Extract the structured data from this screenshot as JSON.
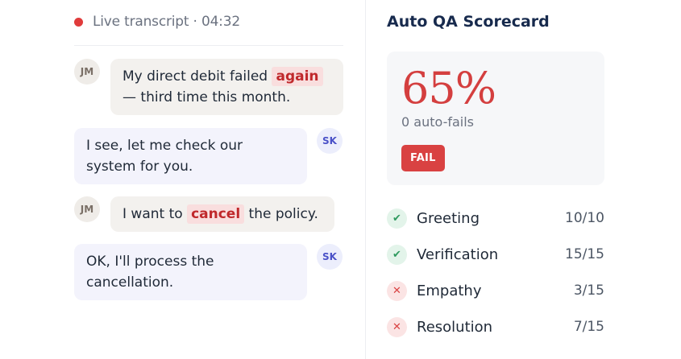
{
  "transcript": {
    "header": "Live transcript · 04:32",
    "messages": [
      {
        "speaker": "JM",
        "role": "customer",
        "pre": "My direct debit failed ",
        "keyword": "again",
        "post": "— third time this month."
      },
      {
        "speaker": "SK",
        "role": "agent",
        "text": "I see, let me check our system for you."
      },
      {
        "speaker": "JM",
        "role": "customer",
        "pre": "I want to ",
        "keyword": "cancel",
        "post": " the policy."
      },
      {
        "speaker": "SK",
        "role": "agent",
        "text": "OK, I'll process the cancellation."
      }
    ]
  },
  "scorecard": {
    "title": "Auto QA Scorecard",
    "score": "65%",
    "auto_fails": "0 auto-fails",
    "status": "FAIL",
    "criteria": [
      {
        "name": "Greeting",
        "score": "10/10",
        "result": "pass"
      },
      {
        "name": "Verification",
        "score": "15/15",
        "result": "pass"
      },
      {
        "name": "Empathy",
        "score": "3/15",
        "result": "fail"
      },
      {
        "name": "Resolution",
        "score": "7/15",
        "result": "fail"
      }
    ]
  },
  "colors": {
    "live_dot": "#e03b3b",
    "score": "#d43f3f",
    "fail_badge": "#d94242",
    "pass": "#2f9a5f",
    "keyword_bg": "#f9dede",
    "keyword_text": "#c0292c"
  },
  "icons": {
    "pass": "check-icon",
    "fail": "x-icon"
  }
}
